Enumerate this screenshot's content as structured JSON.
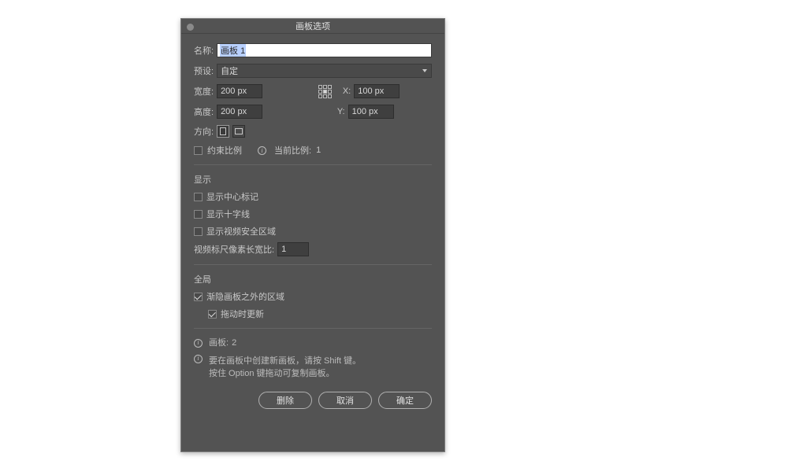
{
  "dialog": {
    "title": "画板选项",
    "name_label": "名称:",
    "name_value": "画板 1",
    "preset_label": "预设:",
    "preset_value": "自定",
    "width_label": "宽度:",
    "width_value": "200 px",
    "height_label": "高度:",
    "height_value": "200 px",
    "x_label": "X:",
    "x_value": "100 px",
    "y_label": "Y:",
    "y_value": "100 px",
    "orient_label": "方向:",
    "constrain_label": "约束比例",
    "ratio_label": "当前比例:",
    "ratio_value": "1"
  },
  "display": {
    "section": "显示",
    "center_mark": "显示中心标记",
    "crosshair": "显示十字线",
    "safe_area": "显示视频安全区域",
    "pixel_ratio_label": "视频标尺像素长宽比:",
    "pixel_ratio_value": "1"
  },
  "global": {
    "section": "全局",
    "fade_outside": "渐隐画板之外的区域",
    "update_drag": "拖动时更新"
  },
  "info": {
    "artboard_count_label": "画板:",
    "artboard_count": "2",
    "hint_line1": "要在画板中创建新画板，请按 Shift 键。",
    "hint_line2": "按住 Option 键拖动可复制画板。"
  },
  "buttons": {
    "delete": "删除",
    "cancel": "取消",
    "ok": "确定"
  }
}
